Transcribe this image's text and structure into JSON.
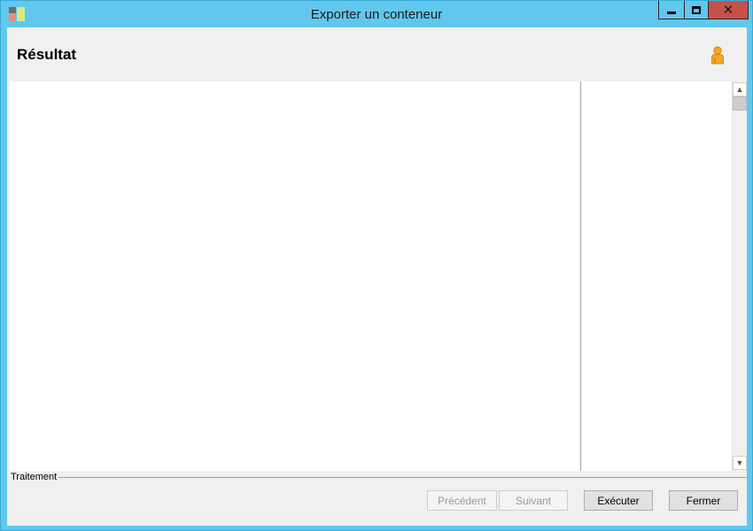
{
  "window": {
    "title": "Exporter un conteneur",
    "controls": {
      "minimize": "minimize-icon",
      "maximize": "maximize-icon",
      "close": "close-icon",
      "close_glyph": "✕"
    }
  },
  "header": {
    "title": "Résultat",
    "icon": "user-icon"
  },
  "scrollbar": {
    "up_glyph": "▲",
    "down_glyph": "▼"
  },
  "group": {
    "label": "Traitement"
  },
  "buttons": {
    "previous": "Précédent",
    "next": "Suivant",
    "execute": "Exécuter",
    "close": "Fermer"
  },
  "colors": {
    "title_bar": "#62c7ec",
    "close_button": "#c7504b",
    "user_icon": "#f5a623"
  }
}
